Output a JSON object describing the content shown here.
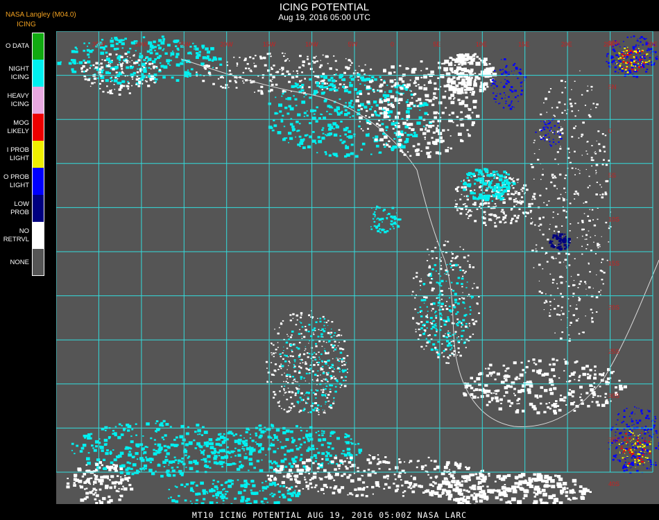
{
  "header": {
    "source_label": "NASA Langley (M04.0)",
    "product_label": "ICING",
    "title": "ICING POTENTIAL",
    "subtitle": "Aug 19, 2016 05:00 UTC"
  },
  "legend": [
    {
      "label": "O DATA",
      "color": "#11aa11"
    },
    {
      "label": "NIGHT\nICING",
      "color": "#00f0f0"
    },
    {
      "label": "HEAVY\nICING",
      "color": "#e8a8e0"
    },
    {
      "label": "MOG\nLIKELY",
      "color": "#ee0000"
    },
    {
      "label": "I PROB\nLIGHT",
      "color": "#f0f000"
    },
    {
      "label": "O PROB\nLIGHT",
      "color": "#0000ff"
    },
    {
      "label": "LOW\nPROB",
      "color": "#000080"
    },
    {
      "label": "NO\nRETRVL",
      "color": "#ffffff"
    },
    {
      "label": "NONE",
      "color": "#555555"
    }
  ],
  "map": {
    "background_color": "#555555",
    "grid_color": "#33dddd",
    "grid_label_color": "#cc2020",
    "coast_color": "#dddddd",
    "longitude_labels": [
      "35W",
      "30W",
      "25W",
      "20W",
      "15W",
      "10W",
      "5W",
      "0",
      "5E",
      "10E",
      "15E",
      "20E",
      "25E",
      "30E",
      "35E"
    ],
    "latitude_labels": [
      "10N",
      "5N",
      "0",
      "5S",
      "10S",
      "15S",
      "20S",
      "25S",
      "30S",
      "35S",
      "40S"
    ]
  },
  "footer": {
    "text": "MT10  ICING POTENTIAL   AUG 19, 2016 05:00Z   NASA LARC"
  }
}
